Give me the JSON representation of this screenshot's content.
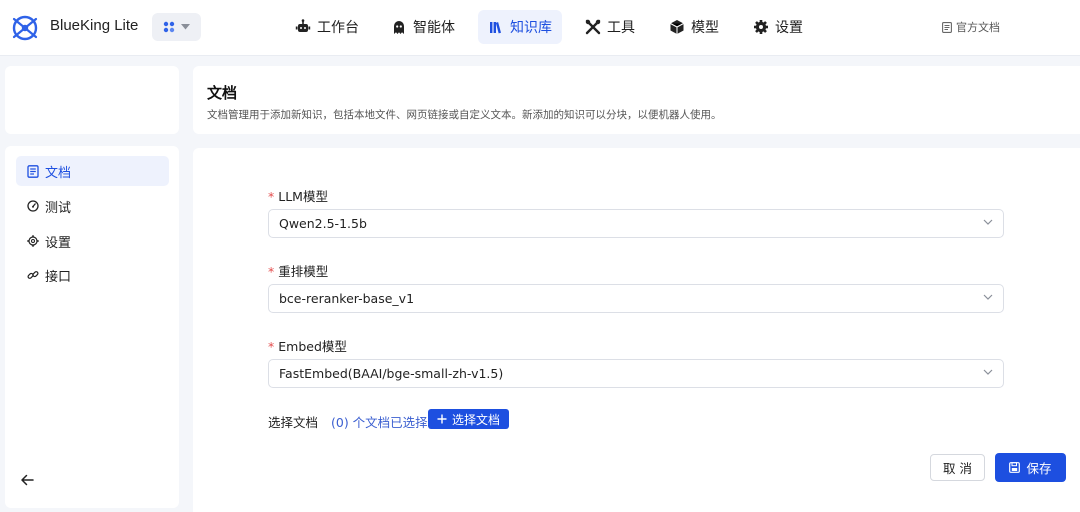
{
  "app": {
    "title": "BlueKing Lite",
    "docs_link": "官方文档"
  },
  "nav": [
    {
      "label": "工作台",
      "icon": "robot-icon"
    },
    {
      "label": "智能体",
      "icon": "ghost-icon"
    },
    {
      "label": "知识库",
      "icon": "books-icon",
      "active": true
    },
    {
      "label": "工具",
      "icon": "tools-icon"
    },
    {
      "label": "模型",
      "icon": "cube-icon"
    },
    {
      "label": "设置",
      "icon": "gear-icon"
    }
  ],
  "sidebar": {
    "items": [
      {
        "label": "文档",
        "icon": "document-icon",
        "active": true
      },
      {
        "label": "测试",
        "icon": "gauge-icon"
      },
      {
        "label": "设置",
        "icon": "gear-icon"
      },
      {
        "label": "接口",
        "icon": "link-icon"
      }
    ]
  },
  "header": {
    "title": "文档",
    "description": "文档管理用于添加新知识，包括本地文件、网页链接或自定义文本。新添加的知识可以分块，以便机器人使用。"
  },
  "form": {
    "llm": {
      "label": "LLM模型",
      "required_mark": "*",
      "value": "Qwen2.5-1.5b"
    },
    "rerank": {
      "label": "重排模型",
      "required_mark": "*",
      "value": "bce-reranker-base_v1"
    },
    "embed": {
      "label": "Embed模型",
      "required_mark": "*",
      "value": "FastEmbed(BAAI/bge-small-zh-v1.5)"
    },
    "docs": {
      "label": "选择文档",
      "count_text": "(0) 个文档已选择",
      "button_label": "选择文档"
    }
  },
  "actions": {
    "cancel_label": "取 消",
    "save_label": "保存"
  },
  "colors": {
    "primary": "#1d4fe0",
    "active_bg": "#eef2fd",
    "required": "#e34d4d",
    "page_bg": "#f4f6fa"
  }
}
